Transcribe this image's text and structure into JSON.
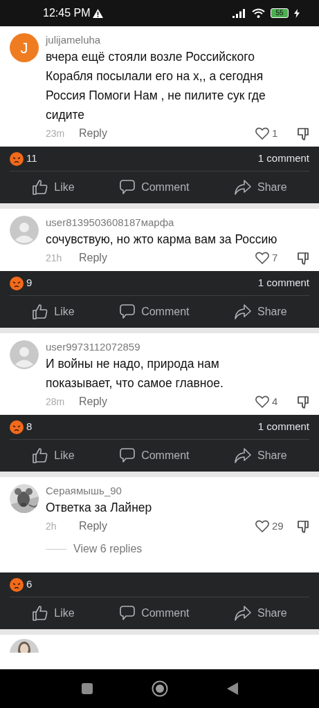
{
  "status_bar": {
    "time": "12:45 PM",
    "battery": "55"
  },
  "posts": [
    {
      "avatar": {
        "kind": "letter",
        "letter": "J",
        "color": "#f07c22"
      },
      "username": "julijameluha",
      "text": "вчера ещё стояли возле Российского Корабля посылали его на х,, а сегодня Россия Помоги Нам , не пилите сук где сидите",
      "time": "23m",
      "reply": "Reply",
      "likes": "1",
      "reactions": "11",
      "comments": "1 comment",
      "actions": [
        "Like",
        "Comment",
        "Share"
      ]
    },
    {
      "avatar": {
        "kind": "default"
      },
      "username": "user8139503608187марфа",
      "text": "сочувствую, но жто карма вам за Россию",
      "time": "21h",
      "reply": "Reply",
      "likes": "7",
      "reactions": "9",
      "comments": "1 comment",
      "actions": [
        "Like",
        "Comment",
        "Share"
      ]
    },
    {
      "avatar": {
        "kind": "default"
      },
      "username": "user9973112072859",
      "text": "И войны не надо, природа нам показывает, что самое главное.",
      "time": "28m",
      "reply": "Reply",
      "likes": "4",
      "reactions": "8",
      "comments": "1 comment",
      "actions": [
        "Like",
        "Comment",
        "Share"
      ]
    },
    {
      "avatar": {
        "kind": "picture"
      },
      "username": "Сераямышь_90",
      "text": "Ответка за Лайнер",
      "time": "2h",
      "reply": "Reply",
      "likes": "29",
      "view_replies": "View 6 replies",
      "reactions": "6",
      "actions": [
        "Like",
        "Comment",
        "Share"
      ]
    }
  ]
}
